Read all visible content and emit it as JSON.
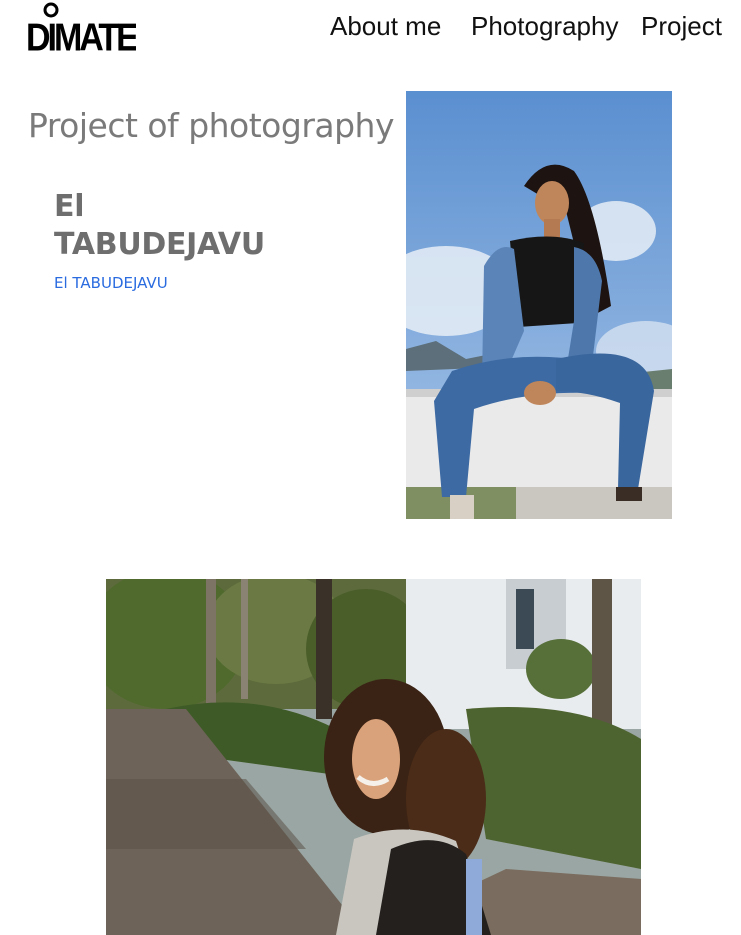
{
  "logo": {
    "text": "DIMATE",
    "icon": "brand-logo-icon"
  },
  "nav": {
    "items": [
      {
        "label": "About me"
      },
      {
        "label": "Photography"
      },
      {
        "label": "Project"
      }
    ]
  },
  "main": {
    "title": "Project of photography",
    "project": {
      "name": "El TABUDEJAVU",
      "link": "El TABUDEJAVU"
    }
  },
  "photos": [
    {
      "subject": "seated-model-photo",
      "colors": {
        "sky": "#6f9fd8",
        "denim": "#3f6fa6"
      }
    },
    {
      "subject": "curly-hair-portrait-photo",
      "colors": {
        "foliage": "#4a5e2a",
        "path": "#6d6358"
      }
    }
  ],
  "colors": {
    "title": "#7a7a7a",
    "project_name": "#6e6e6e",
    "link": "#2a6be0",
    "nav_text": "#111111"
  }
}
